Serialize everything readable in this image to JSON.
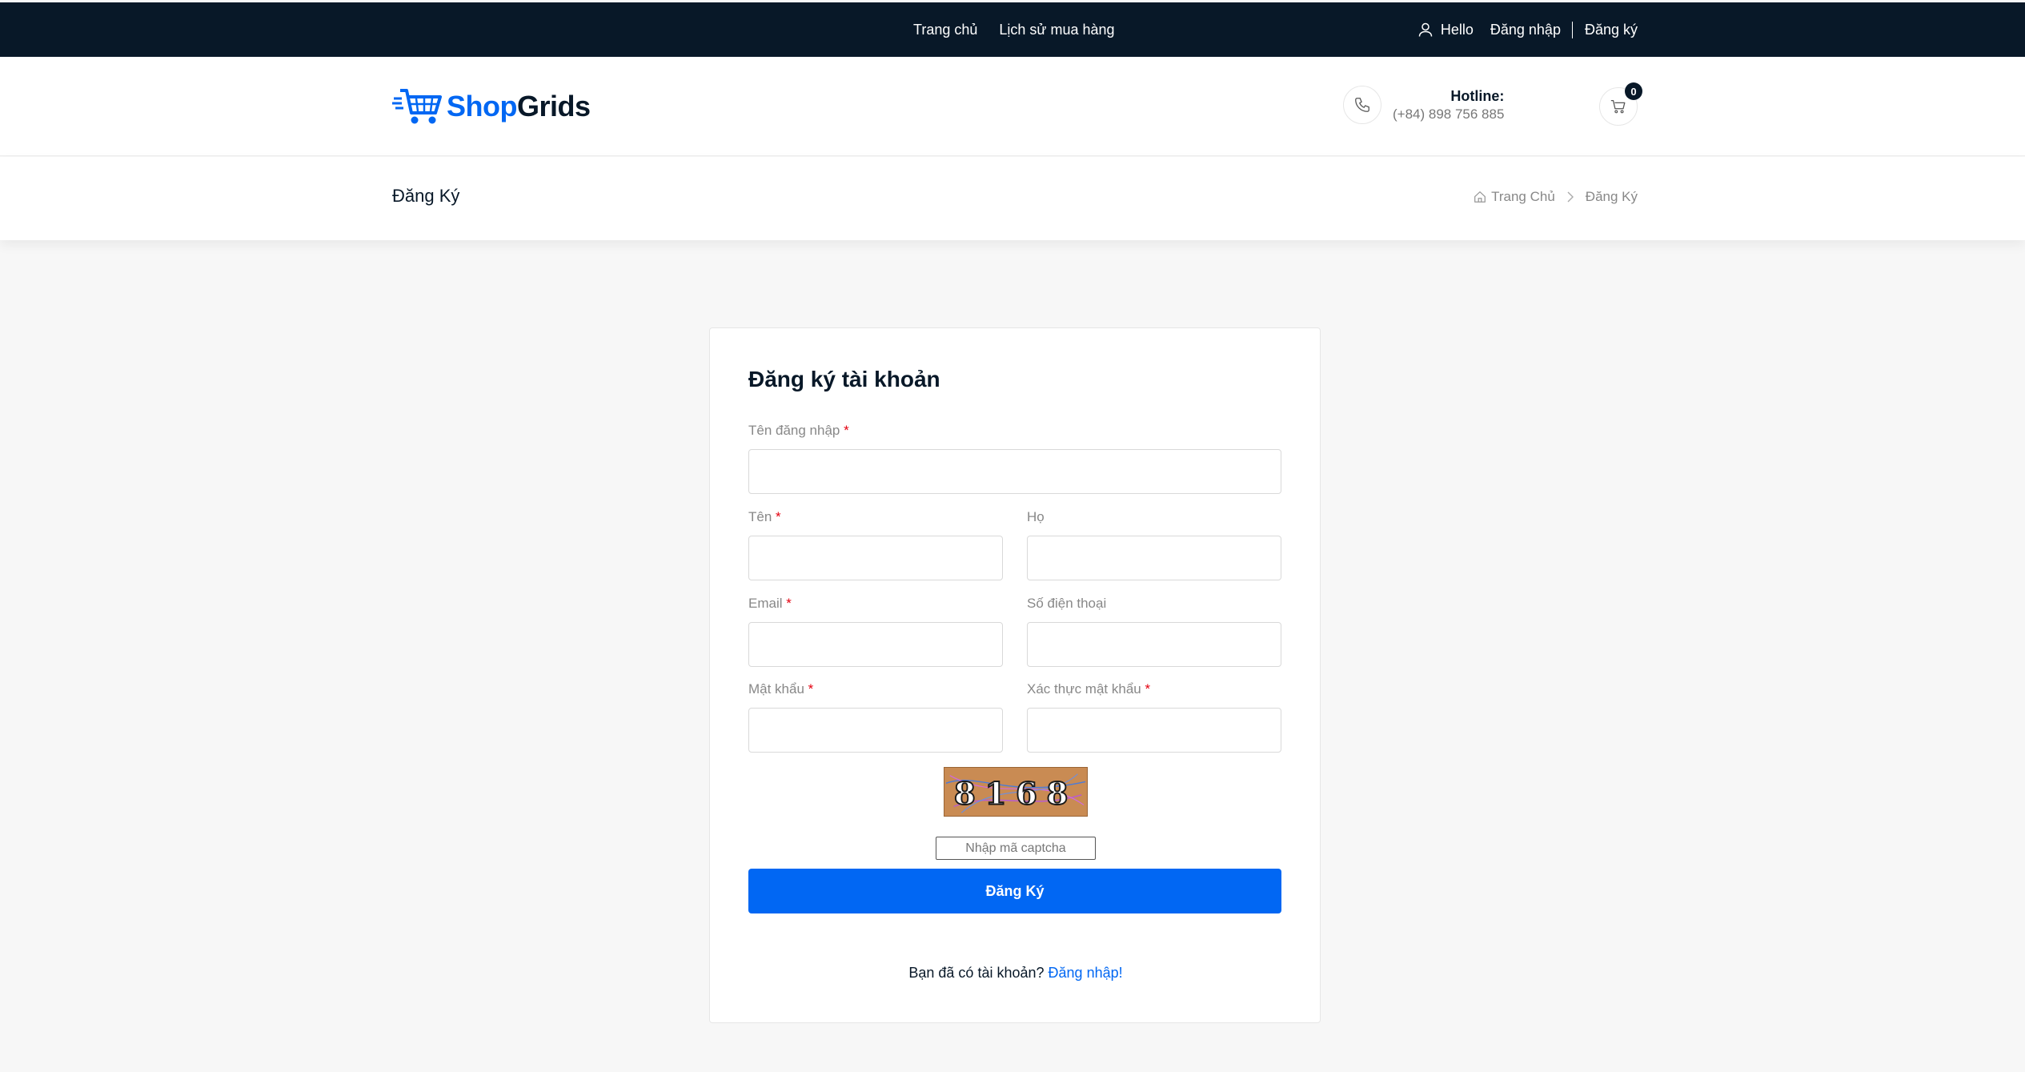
{
  "topbar": {
    "nav": [
      {
        "label": "Trang chủ"
      },
      {
        "label": "Lịch sử mua hàng"
      }
    ],
    "hello": "Hello",
    "login": "Đăng nhập",
    "register": "Đăng ký"
  },
  "header": {
    "brand_shop": "Shop",
    "brand_grids": "Grids",
    "hotline_label": "Hotline:",
    "hotline_number": "(+84) 898 756 885",
    "cart_count": "0"
  },
  "breadcrumb": {
    "page_title": "Đăng Ký",
    "home": "Trang Chủ",
    "current": "Đăng Ký"
  },
  "form": {
    "title": "Đăng ký tài khoản",
    "required_mark": "*",
    "username_label": "Tên đăng nhập",
    "first_name_label": "Tên",
    "last_name_label": "Họ",
    "email_label": "Email",
    "phone_label": "Số điện thoại",
    "password_label": "Mật khẩu",
    "confirm_password_label": "Xác thực mật khẩu",
    "captcha_text": "8168",
    "captcha_placeholder": "Nhập mã captcha",
    "submit_label": "Đăng Ký",
    "have_account_text": "Bạn đã có tài khoản?",
    "login_link": "Đăng nhập!"
  },
  "colors": {
    "dark": "#081828",
    "primary": "#0167f3",
    "required": "#e4000f",
    "page_bg": "#f7f7f7"
  }
}
